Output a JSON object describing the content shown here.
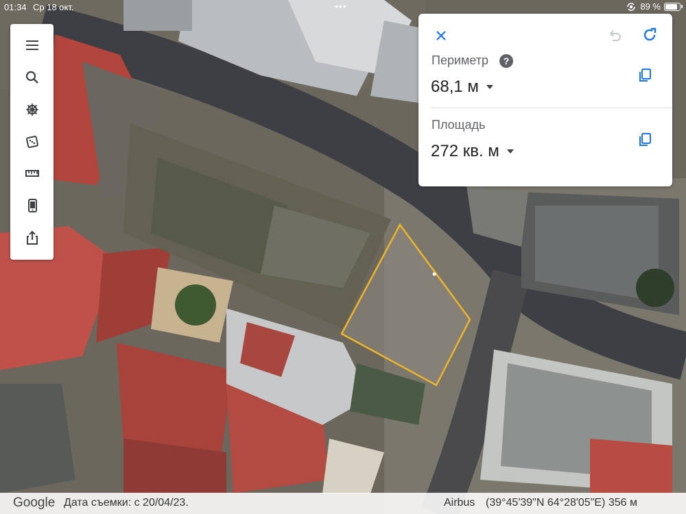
{
  "status_bar": {
    "time": "01:34",
    "date": "Ср 18 окт.",
    "battery": "89 %",
    "battery_level": 0.89
  },
  "toolbar": {
    "items": [
      {
        "icon": "menu-icon"
      },
      {
        "icon": "search-icon"
      },
      {
        "icon": "voyager-wheel-icon"
      },
      {
        "icon": "dice-icon"
      },
      {
        "icon": "ruler-icon"
      },
      {
        "icon": "device-icon"
      },
      {
        "icon": "share-icon"
      }
    ]
  },
  "measure_panel": {
    "perimeter_label": "Периметр",
    "perimeter_value": "68,1 м",
    "area_label": "Площадь",
    "area_value": "272 кв. м",
    "help": "?",
    "accent_color": "#1a73e8"
  },
  "bottom_bar": {
    "logo": "Google",
    "imagery_date": "Дата съемки: с 20/04/23.",
    "provider": "Airbus",
    "coordinates": "(39°45'39\"N 64°28'05\"E) 356 м"
  },
  "colors": {
    "measure_outline": "#f0b429",
    "roof_red": "#b2453c"
  }
}
